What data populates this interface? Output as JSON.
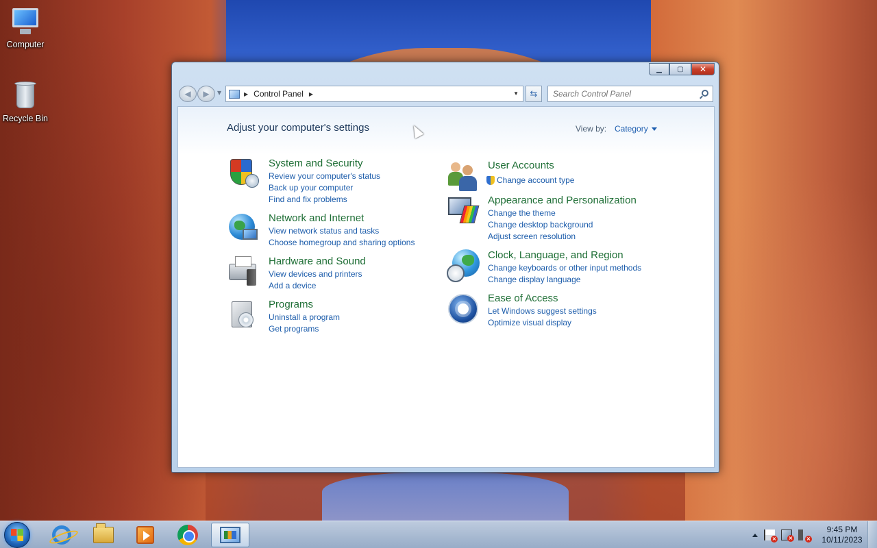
{
  "desktop": {
    "icons": [
      {
        "label": "Computer",
        "icon": "computer-icon"
      },
      {
        "label": "Recycle Bin",
        "icon": "recycle-bin-icon"
      }
    ]
  },
  "window": {
    "title_buttons": {
      "minimize": "minimize-icon",
      "maximize": "maximize-icon",
      "close": "close-icon"
    },
    "address": {
      "crumbs": [
        "Control Panel"
      ]
    },
    "search": {
      "placeholder": "Search Control Panel"
    },
    "heading": "Adjust your computer's settings",
    "view_by": {
      "label": "View by:",
      "value": "Category"
    },
    "categories_left": [
      {
        "title": "System and Security",
        "icon": "security-shield-icon",
        "links": [
          "Review your computer's status",
          "Back up your computer",
          "Find and fix problems"
        ]
      },
      {
        "title": "Network and Internet",
        "icon": "network-globe-icon",
        "links": [
          "View network status and tasks",
          "Choose homegroup and sharing options"
        ]
      },
      {
        "title": "Hardware and Sound",
        "icon": "printer-speaker-icon",
        "links": [
          "View devices and printers",
          "Add a device"
        ]
      },
      {
        "title": "Programs",
        "icon": "programs-disc-icon",
        "links": [
          "Uninstall a program",
          "Get programs"
        ]
      }
    ],
    "categories_right": [
      {
        "title": "User Accounts",
        "icon": "users-icon",
        "links": [
          "Change account type"
        ]
      },
      {
        "title": "Appearance and Personalization",
        "icon": "monitor-palette-icon",
        "links": [
          "Change the theme",
          "Change desktop background",
          "Adjust screen resolution"
        ]
      },
      {
        "title": "Clock, Language, and Region",
        "icon": "globe-clock-icon",
        "links": [
          "Change keyboards or other input methods",
          "Change display language"
        ]
      },
      {
        "title": "Ease of Access",
        "icon": "ease-of-access-icon",
        "links": [
          "Let Windows suggest settings",
          "Optimize visual display"
        ]
      }
    ]
  },
  "taskbar": {
    "pinned": [
      "internet-explorer-icon",
      "file-explorer-icon",
      "media-player-icon",
      "chrome-icon",
      "control-panel-icon"
    ],
    "clock": {
      "time": "9:45 PM",
      "date": "10/11/2023"
    }
  },
  "colors": {
    "link": "#1d5dab",
    "category_title": "#1e6e35",
    "heading": "#1e395b"
  }
}
